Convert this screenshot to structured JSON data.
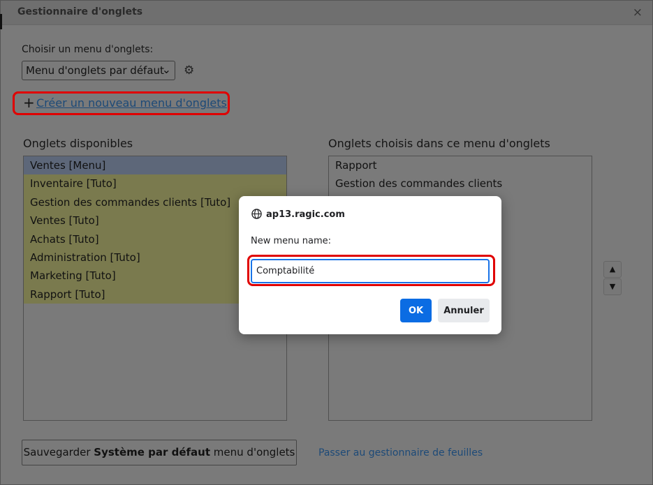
{
  "dialog": {
    "title": "Gestionnaire d'onglets",
    "close_icon": "×"
  },
  "menu_select": {
    "label": "Choisir un menu d'onglets:",
    "value": "Menu d'onglets par défaut"
  },
  "create_link": {
    "plus": "+",
    "text": "Créer un nouveau menu d'onglets"
  },
  "available": {
    "header": "Onglets disponibles",
    "items": [
      "Ventes [Menu]",
      "Inventaire [Tuto]",
      "Gestion des commandes clients [Tuto]",
      "Ventes [Tuto]",
      "Achats [Tuto]",
      "Administration [Tuto]",
      "Marketing [Tuto]",
      "Rapport [Tuto]"
    ]
  },
  "chosen": {
    "header": "Onglets choisis dans ce menu d'onglets",
    "items": [
      "Rapport",
      "Gestion des commandes clients"
    ]
  },
  "footer": {
    "save_prefix": "Sauvegarder ",
    "save_bold": "Système par défaut",
    "save_suffix": " menu d'onglets",
    "switch_link": "Passer au gestionnaire de feuilles"
  },
  "prompt": {
    "origin": "ap13.ragic.com",
    "message": "New menu name:",
    "input_value": "Comptabilité",
    "ok_label": "OK",
    "cancel_label": "Annuler"
  },
  "colors": {
    "highlight": "#e00000",
    "ok_button": "#0b6ce3",
    "link": "#1d4a78"
  }
}
